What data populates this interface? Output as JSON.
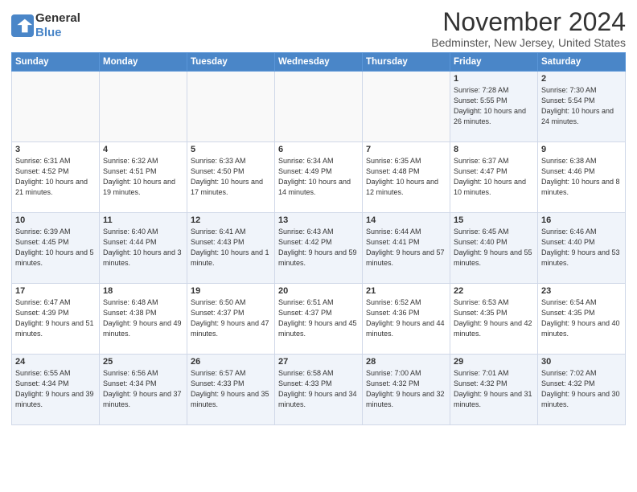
{
  "header": {
    "logo_line1": "General",
    "logo_line2": "Blue",
    "month": "November 2024",
    "location": "Bedminster, New Jersey, United States"
  },
  "days_of_week": [
    "Sunday",
    "Monday",
    "Tuesday",
    "Wednesday",
    "Thursday",
    "Friday",
    "Saturday"
  ],
  "weeks": [
    [
      {
        "day": "",
        "info": ""
      },
      {
        "day": "",
        "info": ""
      },
      {
        "day": "",
        "info": ""
      },
      {
        "day": "",
        "info": ""
      },
      {
        "day": "",
        "info": ""
      },
      {
        "day": "1",
        "info": "Sunrise: 7:28 AM\nSunset: 5:55 PM\nDaylight: 10 hours and 26 minutes."
      },
      {
        "day": "2",
        "info": "Sunrise: 7:30 AM\nSunset: 5:54 PM\nDaylight: 10 hours and 24 minutes."
      }
    ],
    [
      {
        "day": "3",
        "info": "Sunrise: 6:31 AM\nSunset: 4:52 PM\nDaylight: 10 hours and 21 minutes."
      },
      {
        "day": "4",
        "info": "Sunrise: 6:32 AM\nSunset: 4:51 PM\nDaylight: 10 hours and 19 minutes."
      },
      {
        "day": "5",
        "info": "Sunrise: 6:33 AM\nSunset: 4:50 PM\nDaylight: 10 hours and 17 minutes."
      },
      {
        "day": "6",
        "info": "Sunrise: 6:34 AM\nSunset: 4:49 PM\nDaylight: 10 hours and 14 minutes."
      },
      {
        "day": "7",
        "info": "Sunrise: 6:35 AM\nSunset: 4:48 PM\nDaylight: 10 hours and 12 minutes."
      },
      {
        "day": "8",
        "info": "Sunrise: 6:37 AM\nSunset: 4:47 PM\nDaylight: 10 hours and 10 minutes."
      },
      {
        "day": "9",
        "info": "Sunrise: 6:38 AM\nSunset: 4:46 PM\nDaylight: 10 hours and 8 minutes."
      }
    ],
    [
      {
        "day": "10",
        "info": "Sunrise: 6:39 AM\nSunset: 4:45 PM\nDaylight: 10 hours and 5 minutes."
      },
      {
        "day": "11",
        "info": "Sunrise: 6:40 AM\nSunset: 4:44 PM\nDaylight: 10 hours and 3 minutes."
      },
      {
        "day": "12",
        "info": "Sunrise: 6:41 AM\nSunset: 4:43 PM\nDaylight: 10 hours and 1 minute."
      },
      {
        "day": "13",
        "info": "Sunrise: 6:43 AM\nSunset: 4:42 PM\nDaylight: 9 hours and 59 minutes."
      },
      {
        "day": "14",
        "info": "Sunrise: 6:44 AM\nSunset: 4:41 PM\nDaylight: 9 hours and 57 minutes."
      },
      {
        "day": "15",
        "info": "Sunrise: 6:45 AM\nSunset: 4:40 PM\nDaylight: 9 hours and 55 minutes."
      },
      {
        "day": "16",
        "info": "Sunrise: 6:46 AM\nSunset: 4:40 PM\nDaylight: 9 hours and 53 minutes."
      }
    ],
    [
      {
        "day": "17",
        "info": "Sunrise: 6:47 AM\nSunset: 4:39 PM\nDaylight: 9 hours and 51 minutes."
      },
      {
        "day": "18",
        "info": "Sunrise: 6:48 AM\nSunset: 4:38 PM\nDaylight: 9 hours and 49 minutes."
      },
      {
        "day": "19",
        "info": "Sunrise: 6:50 AM\nSunset: 4:37 PM\nDaylight: 9 hours and 47 minutes."
      },
      {
        "day": "20",
        "info": "Sunrise: 6:51 AM\nSunset: 4:37 PM\nDaylight: 9 hours and 45 minutes."
      },
      {
        "day": "21",
        "info": "Sunrise: 6:52 AM\nSunset: 4:36 PM\nDaylight: 9 hours and 44 minutes."
      },
      {
        "day": "22",
        "info": "Sunrise: 6:53 AM\nSunset: 4:35 PM\nDaylight: 9 hours and 42 minutes."
      },
      {
        "day": "23",
        "info": "Sunrise: 6:54 AM\nSunset: 4:35 PM\nDaylight: 9 hours and 40 minutes."
      }
    ],
    [
      {
        "day": "24",
        "info": "Sunrise: 6:55 AM\nSunset: 4:34 PM\nDaylight: 9 hours and 39 minutes."
      },
      {
        "day": "25",
        "info": "Sunrise: 6:56 AM\nSunset: 4:34 PM\nDaylight: 9 hours and 37 minutes."
      },
      {
        "day": "26",
        "info": "Sunrise: 6:57 AM\nSunset: 4:33 PM\nDaylight: 9 hours and 35 minutes."
      },
      {
        "day": "27",
        "info": "Sunrise: 6:58 AM\nSunset: 4:33 PM\nDaylight: 9 hours and 34 minutes."
      },
      {
        "day": "28",
        "info": "Sunrise: 7:00 AM\nSunset: 4:32 PM\nDaylight: 9 hours and 32 minutes."
      },
      {
        "day": "29",
        "info": "Sunrise: 7:01 AM\nSunset: 4:32 PM\nDaylight: 9 hours and 31 minutes."
      },
      {
        "day": "30",
        "info": "Sunrise: 7:02 AM\nSunset: 4:32 PM\nDaylight: 9 hours and 30 minutes."
      }
    ]
  ]
}
